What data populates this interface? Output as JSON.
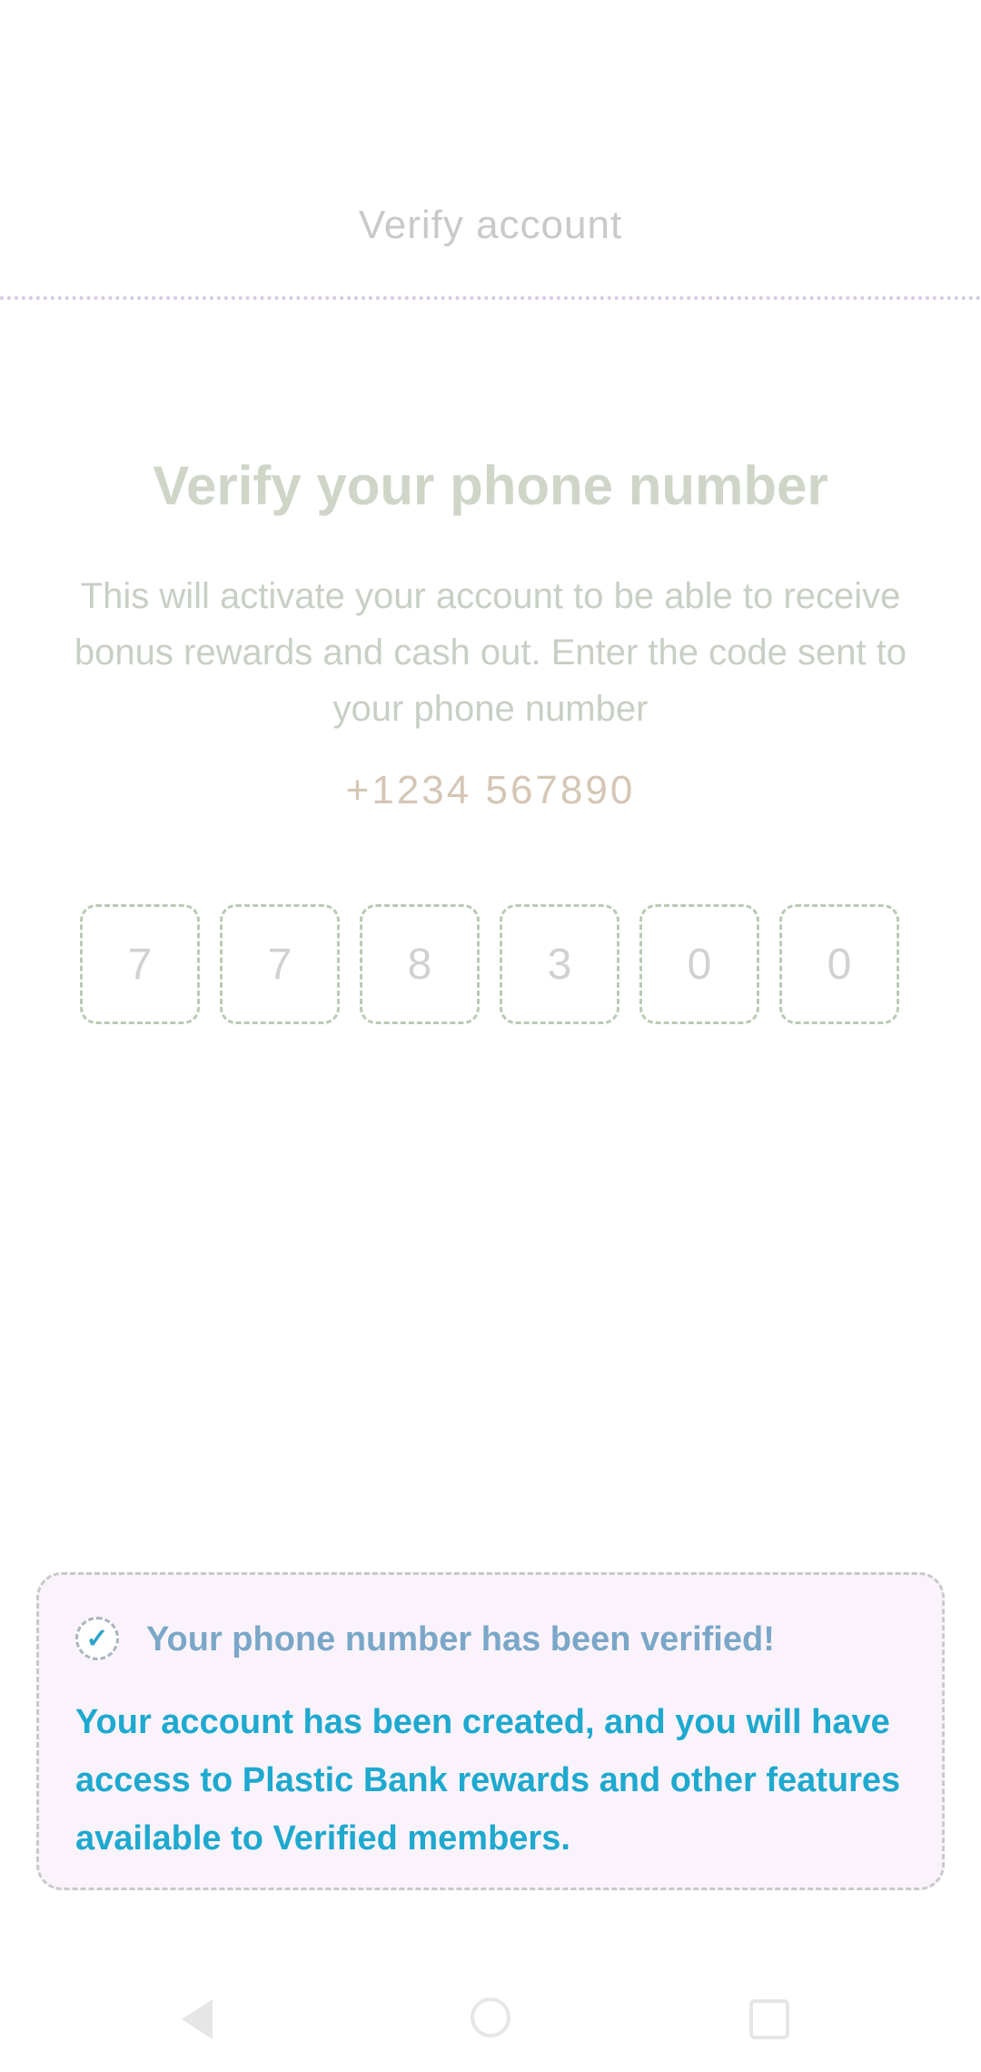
{
  "header": {
    "title": "Verify account"
  },
  "main": {
    "title": "Verify your phone number",
    "description": "This will activate your account to be able to receive bonus rewards and cash out. Enter the code sent to your phone number",
    "phone": "+1234 567890",
    "code_digits": [
      "7",
      "7",
      "8",
      "3",
      "0",
      "0"
    ]
  },
  "success": {
    "title": "Your phone number has been verified!",
    "body": "Your account has been created, and you will have access to Plastic Bank rewards and other features available to Verified members."
  },
  "nav": {
    "back_icon": "back-triangle-icon",
    "home_icon": "home-circle-icon",
    "recents_icon": "recents-square-icon"
  }
}
